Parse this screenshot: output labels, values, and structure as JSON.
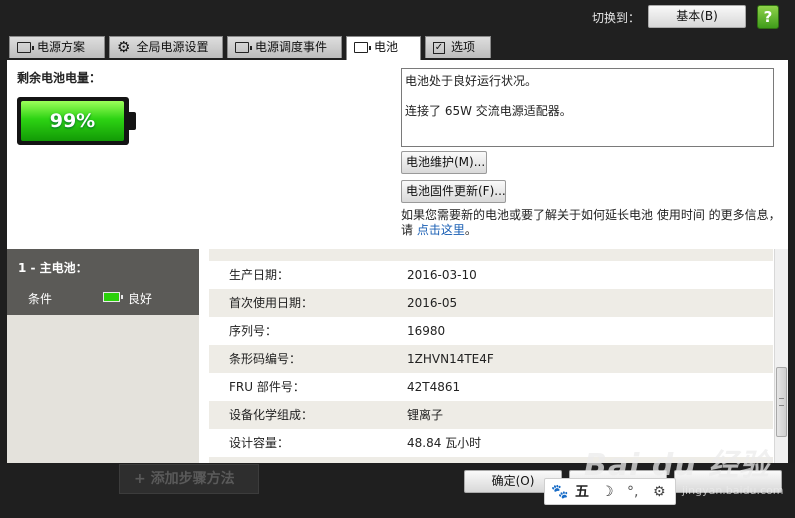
{
  "header": {
    "switch_label": "切换到：",
    "basic_button": "基本(B)",
    "help_icon": "help-icon"
  },
  "tabs": [
    {
      "label": "电源方案",
      "icon": "battery-outline-icon"
    },
    {
      "label": "全局电源设置",
      "icon": "gear-icon"
    },
    {
      "label": "电源调度事件",
      "icon": "battery-outline-icon"
    },
    {
      "label": "电池",
      "icon": "battery-outline-icon",
      "active": true
    },
    {
      "label": "选项",
      "icon": "checkbox-icon"
    }
  ],
  "battery": {
    "remaining_label": "剩余电池电量：",
    "percent_text": "99%",
    "level": 0.99,
    "status_line1": "电池处于良好运行状况。",
    "status_line2": "连接了 65W 交流电源适配器。",
    "maintenance_button": "电池维护(M)...",
    "firmware_button": "电池固件更新(F)...",
    "hint_text": "如果您需要新的电池或要了解关于如何延长电池 使用时间 的更多信息，请 ",
    "hint_link": "点击这里",
    "hint_end": "。"
  },
  "battery_list": {
    "title": "1 - 主电池：",
    "condition_label": "条件",
    "condition_value": "良好"
  },
  "details": [
    {
      "key": "生产日期：",
      "value": "2016-03-10"
    },
    {
      "key": "首次使用日期：",
      "value": "2016-05"
    },
    {
      "key": "序列号：",
      "value": "16980"
    },
    {
      "key": "条形码编号：",
      "value": "1ZHVN14TE4F"
    },
    {
      "key": "FRU 部件号：",
      "value": "42T4861"
    },
    {
      "key": "设备化学组成：",
      "value": "锂离子"
    },
    {
      "key": "设计容量：",
      "value": "48.84 瓦小时"
    }
  ],
  "footer": {
    "add_step": "+ 添加步骤方法",
    "ok_button": "确定(O)"
  },
  "ime": {
    "paw": "🐾",
    "five": "五",
    "moon": "☽",
    "dots": "°,",
    "cog": "⚙"
  },
  "watermark": {
    "main": "Bai du 经验",
    "sub": "jingyan.baidu.com"
  }
}
